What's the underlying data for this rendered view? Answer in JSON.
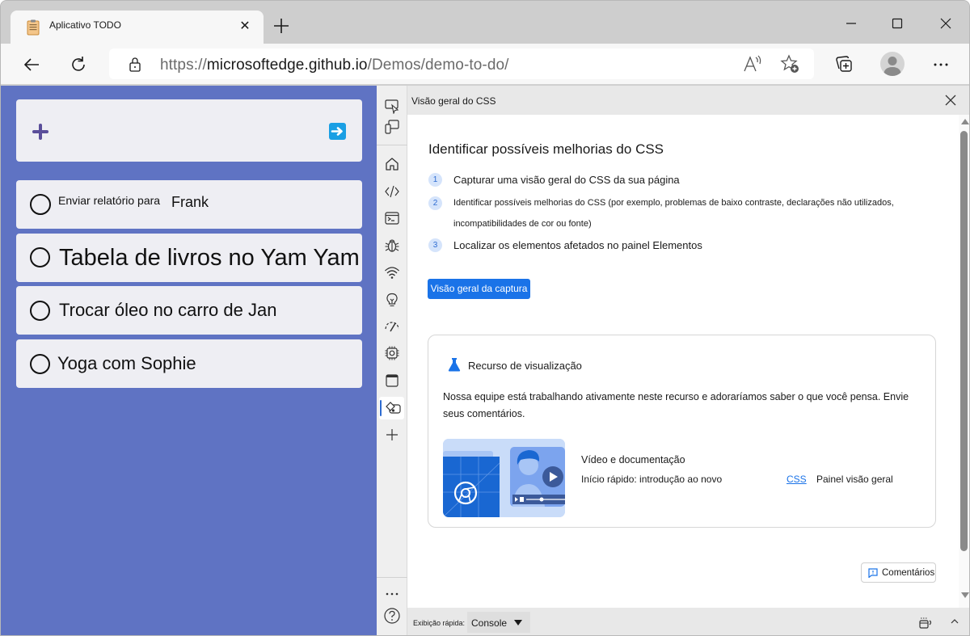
{
  "browser": {
    "tab": {
      "title": "Aplicativo TODO",
      "favicon": "clipboard-icon",
      "close_icon": "close-icon"
    },
    "new_tab_icon": "plus-icon",
    "window_controls": [
      "minimize-icon",
      "maximize-icon",
      "close-icon"
    ],
    "toolbar": {
      "back_icon": "arrow-left-icon",
      "refresh_icon": "refresh-icon",
      "lock_icon": "lock-icon",
      "url_scheme": "https://",
      "url_host": "microsoftedge.github.io",
      "url_path": "/Demos/demo-to-do/",
      "read_aloud_icon": "read-aloud-icon",
      "favorite_icon": "star-add-icon",
      "collections_icon": "collections-icon",
      "profile_icon": "avatar",
      "more_icon": "more-icon"
    }
  },
  "todo_app": {
    "add_icon": "plus-icon",
    "submit_icon": "arrow-right-icon",
    "colors": {
      "background": "#5f73c3",
      "card": "#eeeef3",
      "plus": "#5a4e9a",
      "submit": "#1a9fe4"
    },
    "items": [
      {
        "text_prefix": "Enviar relatório para",
        "text_suffix": "Frank",
        "done": false
      },
      {
        "text": "Tabela de livros no Yam Yam",
        "done": false
      },
      {
        "text": "Trocar óleo no carro de Jan",
        "done": false
      },
      {
        "text": "Yoga com Sophie",
        "done": false
      }
    ]
  },
  "devtools": {
    "activity_bar": [
      {
        "name": "inspect-icon",
        "label": "Inspecionar"
      },
      {
        "name": "device-emulation-icon",
        "label": "Emulação de dispositivo"
      },
      {
        "name": "home-icon",
        "label": "Início"
      },
      {
        "name": "elements-icon",
        "label": "Elementos"
      },
      {
        "name": "console-icon",
        "label": "Console"
      },
      {
        "name": "sources-bug-icon",
        "label": "Fontes"
      },
      {
        "name": "network-icon",
        "label": "Rede"
      },
      {
        "name": "lightbulb-icon",
        "label": "Performance insights"
      },
      {
        "name": "performance-icon",
        "label": "Desempenho"
      },
      {
        "name": "memory-icon",
        "label": "Memória"
      },
      {
        "name": "application-icon",
        "label": "Aplicativo"
      },
      {
        "name": "css-overview-icon",
        "label": "Visão geral do CSS",
        "active": true
      },
      {
        "name": "add-tool-icon",
        "label": "Mais ferramentas"
      }
    ],
    "bottom_icons": [
      "more-icon",
      "help-icon"
    ],
    "panel": {
      "title": "Visão geral do CSS",
      "heading": "Identificar possíveis melhorias do CSS",
      "steps": [
        {
          "num": "1",
          "text": "Capturar uma visão geral do CSS da sua página"
        },
        {
          "num": "2",
          "text": "Identificar possíveis melhorias do CSS (por exemplo, problemas de baixo contraste, declarações não utilizados, incompatibilidades de cor ou fonte)"
        },
        {
          "num": "3",
          "text": "Localizar os elementos afetados no painel Elementos"
        }
      ],
      "capture_button": "Visão geral da captura",
      "preview": {
        "icon": "flask-icon",
        "title": "Recurso de visualização",
        "description": "Nossa equipe está trabalhando ativamente neste recurso e adoraríamos saber o que você pensa. Envie seus comentários.",
        "video_title": "Vídeo e documentação",
        "link_prefix": "Início rápido: introdução ao novo",
        "link_css": "CSS",
        "link_suffix": "Painel visão geral"
      },
      "feedback_button": "Comentários",
      "accent": "#1a73e8"
    },
    "drawer": {
      "label": "Exibição rápida:",
      "selected": "Console",
      "dock_icon": "dock-icon",
      "expand_icon": "chevron-up-icon"
    }
  }
}
